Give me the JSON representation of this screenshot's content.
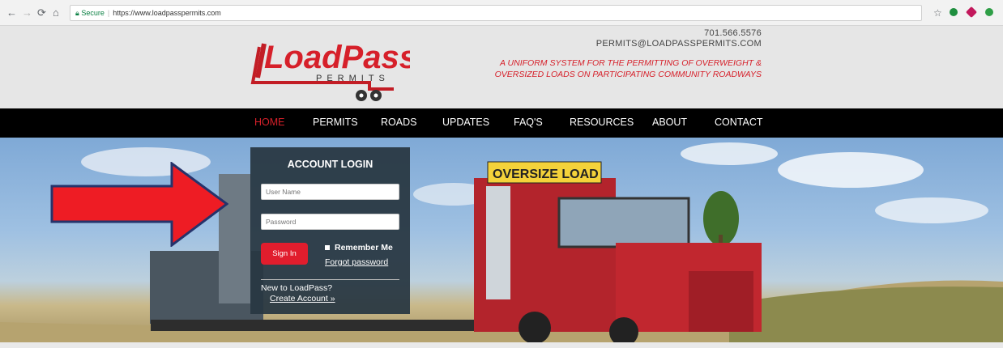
{
  "browser": {
    "back_icon": "back-arrow-icon",
    "forward_icon": "forward-arrow-icon",
    "reload_icon": "reload-icon",
    "home_icon": "home-icon",
    "secure_label": "Secure",
    "url": "https://www.loadpasspermits.com"
  },
  "header": {
    "logo_text": "LoadPass",
    "logo_sub": "PERMITS",
    "phone": "701.566.5576",
    "email": "PERMITS@LOADPASSPERMITS.COM",
    "tagline_line1": "A UNIFORM SYSTEM FOR THE PERMITTING OF OVERWEIGHT &",
    "tagline_line2": "OVERSIZED LOADS ON PARTICIPATING COMMUNITY ROADWAYS",
    "accent_color": "#d6202a"
  },
  "nav": {
    "items": [
      {
        "label": "HOME",
        "active": true
      },
      {
        "label": "PERMITS"
      },
      {
        "label": "ROADS"
      },
      {
        "label": "UPDATES"
      },
      {
        "label": "FAQ'S"
      },
      {
        "label": "RESOURCES"
      },
      {
        "label": "ABOUT"
      },
      {
        "label": "CONTACT"
      }
    ]
  },
  "login": {
    "title": "ACCOUNT LOGIN",
    "username_placeholder": "User Name",
    "password_placeholder": "Password",
    "signin_label": "Sign In",
    "remember_label": "Remember Me",
    "forgot_label": "Forgot password",
    "new_prompt": "New to LoadPass?",
    "create_label": "Create Account »"
  },
  "hero": {
    "truck_sign": "OVERSIZE LOAD"
  }
}
